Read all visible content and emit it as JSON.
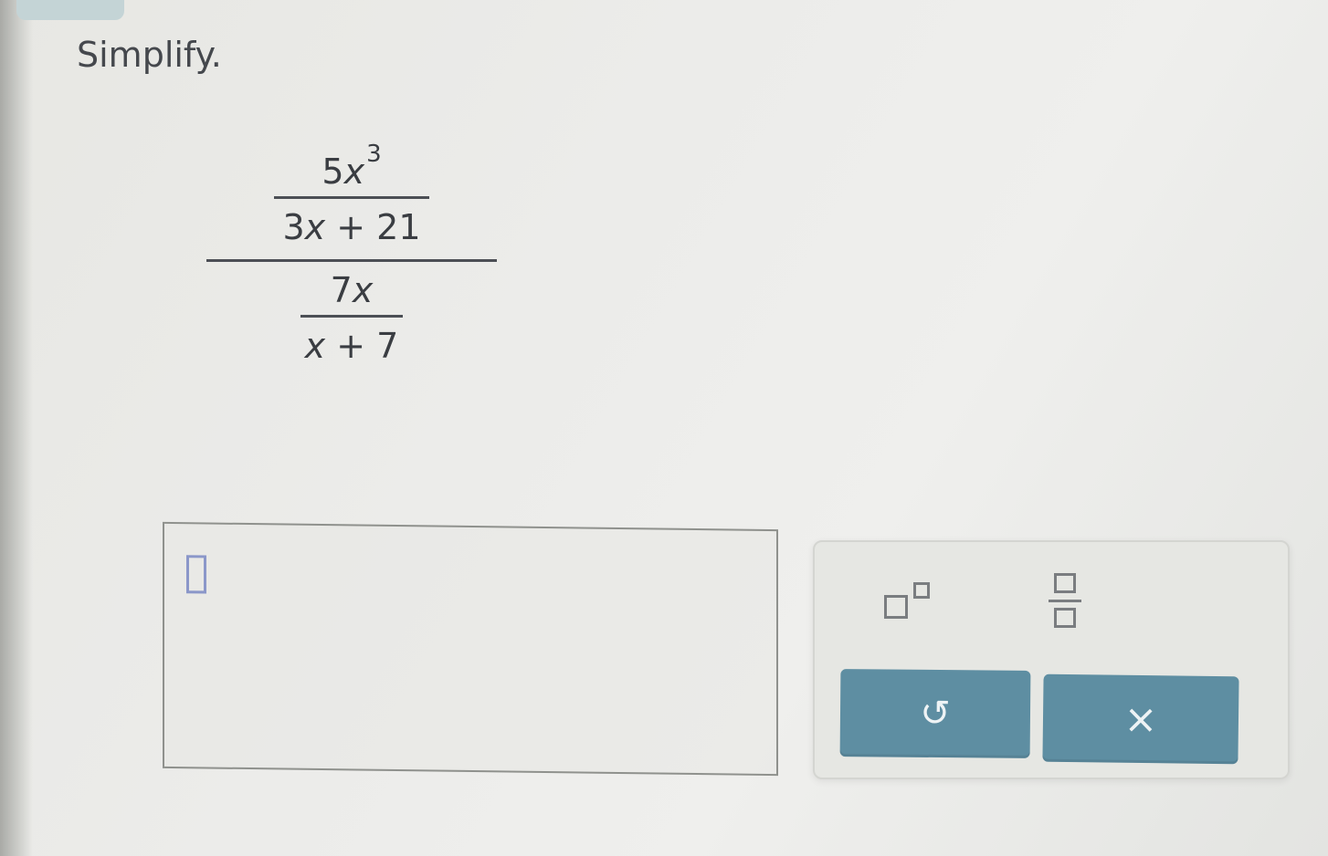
{
  "prompt": "Simplify.",
  "expression": {
    "top": {
      "numerator": {
        "coefficient": "5",
        "variable": "x",
        "exponent": "3"
      },
      "denominator": {
        "coefficient": "3",
        "variable": "x",
        "rest": " + 21"
      }
    },
    "bottom": {
      "numerator": {
        "coefficient": "7",
        "variable": "x"
      },
      "denominator": {
        "variable": "x",
        "rest": " + 7"
      }
    }
  },
  "answer": {
    "value": ""
  },
  "keypad": {
    "exponent_key": "exponent-template",
    "fraction_key": "fraction-template",
    "undo_label": "↺",
    "clear_label": "×"
  },
  "colors": {
    "button": "#5e8ea2",
    "cursor": "#8b97c9",
    "text": "#3a3d42"
  }
}
